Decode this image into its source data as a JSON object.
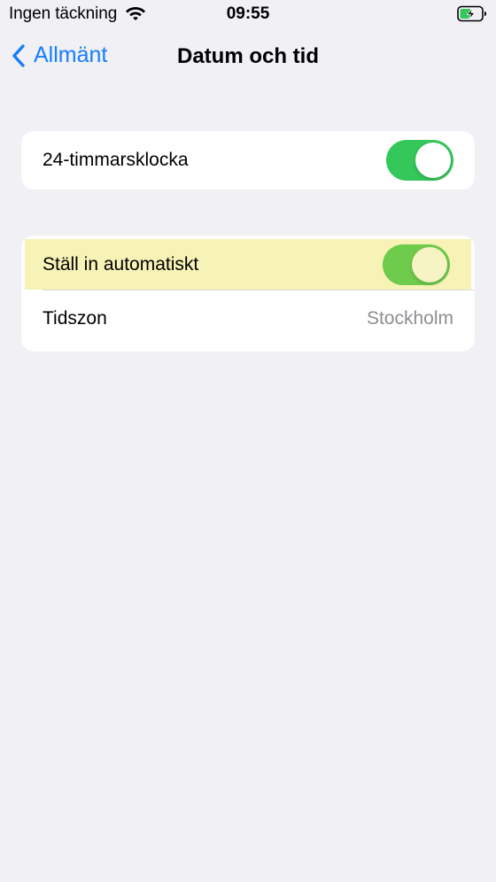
{
  "status_bar": {
    "carrier": "Ingen täckning",
    "time": "09:55",
    "wifi_icon": "wifi-icon",
    "battery_icon": "battery-charging-icon"
  },
  "nav": {
    "back_label": "Allmänt",
    "title": "Datum och tid"
  },
  "settings": {
    "clock24": {
      "label": "24-timmarsklocka",
      "on": true
    },
    "auto_set": {
      "label": "Ställ in automatiskt",
      "on": true
    },
    "timezone": {
      "label": "Tidszon",
      "value": "Stockholm"
    }
  },
  "colors": {
    "accent": "#147efb",
    "toggle_on": "#34c759",
    "highlight": "#f7f2b6",
    "background": "#f0f0f5"
  }
}
